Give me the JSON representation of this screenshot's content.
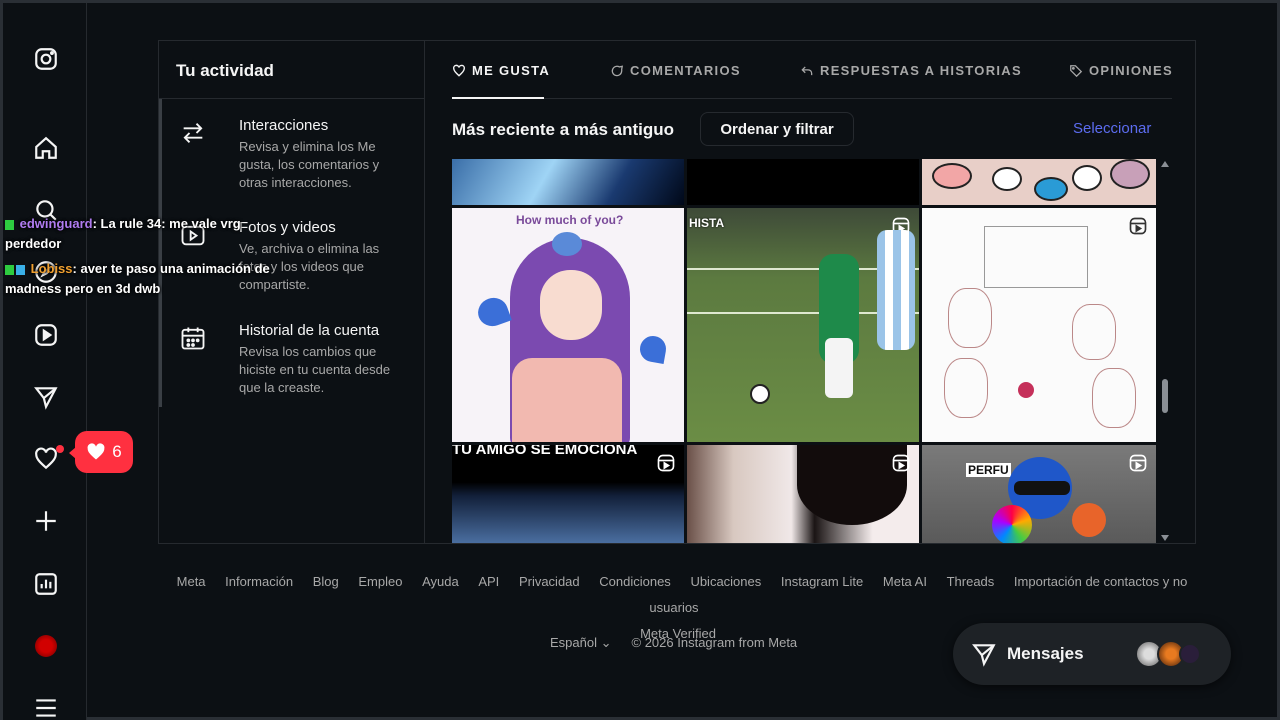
{
  "nav": {
    "items": [
      "instagram-icon",
      "home-icon",
      "search-icon",
      "explore-icon",
      "reels-icon",
      "messages-icon",
      "notifications-icon",
      "create-icon",
      "dashboard-icon",
      "profile-icon",
      "more-icon"
    ],
    "like_count": "6"
  },
  "activity": {
    "title": "Tu actividad",
    "items": [
      {
        "title": "Interacciones",
        "desc": "Revisa y elimina los Me gusta, los comentarios y otras interacciones."
      },
      {
        "title": "Fotos y videos",
        "desc": "Ve, archiva o elimina las fotos y los videos que compartiste."
      },
      {
        "title": "Historial de la cuenta",
        "desc": "Revisa los cambios que hiciste en tu cuenta desde que la creaste."
      }
    ]
  },
  "tabs": [
    "ME GUSTA",
    "COMENTARIOS",
    "RESPUESTAS A HISTORIAS",
    "OPINIONES"
  ],
  "sort": {
    "title": "Más reciente a más antiguo",
    "filter_label": "Ordenar y filtrar",
    "select_label": "Seleccionar"
  },
  "grid": {
    "captions": [
      "How much of you?",
      "HISTA",
      "TU AMIGO SE EMOCIONA",
      "PERFU"
    ]
  },
  "footer": {
    "links": [
      "Meta",
      "Información",
      "Blog",
      "Empleo",
      "Ayuda",
      "API",
      "Privacidad",
      "Condiciones",
      "Ubicaciones",
      "Instagram Lite",
      "Meta AI",
      "Threads",
      "Importación de contactos y no usuarios",
      "Meta Verified"
    ],
    "language": "Español",
    "copyright": "© 2026 Instagram from Meta"
  },
  "messages": {
    "label": "Mensajes"
  },
  "chat": [
    {
      "user": "edwinguard",
      "text": ": La rule 34: me vale vrg perdedor"
    },
    {
      "user": "Lobiss",
      "text": ": aver te paso una animación de madness pero en 3d dwb"
    }
  ],
  "colors": {
    "accent": "#5c6cf0",
    "notification": "#ff3040",
    "background": "#0c1014"
  }
}
